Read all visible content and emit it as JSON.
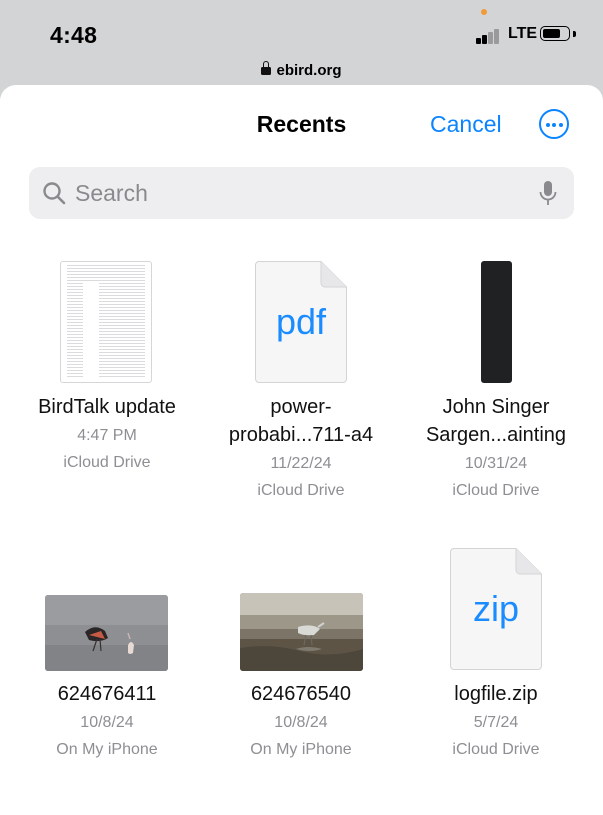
{
  "status_bar": {
    "time": "4:48",
    "network": "LTE"
  },
  "browser": {
    "url": "ebird.org"
  },
  "sheet": {
    "title": "Recents",
    "cancel_label": "Cancel",
    "search": {
      "placeholder": "Search",
      "value": ""
    }
  },
  "files": [
    {
      "name_lines": [
        "BirdTalk update"
      ],
      "date": "4:47 PM",
      "location": "iCloud Drive",
      "thumb": "document-preview"
    },
    {
      "name_lines": [
        "power-",
        "probabi...711-a4"
      ],
      "date": "11/22/24",
      "location": "iCloud Drive",
      "thumb": "pdf-icon",
      "icon_label": "pdf"
    },
    {
      "name_lines": [
        "John Singer",
        "Sargen...ainting"
      ],
      "date": "10/31/24",
      "location": "iCloud Drive",
      "thumb": "dark-image"
    },
    {
      "name_lines": [
        "624676411"
      ],
      "date": "10/8/24",
      "location": "On My iPhone",
      "thumb": "bird-photo"
    },
    {
      "name_lines": [
        "624676540"
      ],
      "date": "10/8/24",
      "location": "On My iPhone",
      "thumb": "bird-photo"
    },
    {
      "name_lines": [
        "logfile.zip"
      ],
      "date": "5/7/24",
      "location": "iCloud Drive",
      "thumb": "zip-icon",
      "icon_label": "zip"
    }
  ],
  "colors": {
    "accent": "#0a84ff",
    "file_icon_text": "#1a8cff",
    "secondary_text": "#8e8e93",
    "notification_dot": "#f19a38"
  }
}
